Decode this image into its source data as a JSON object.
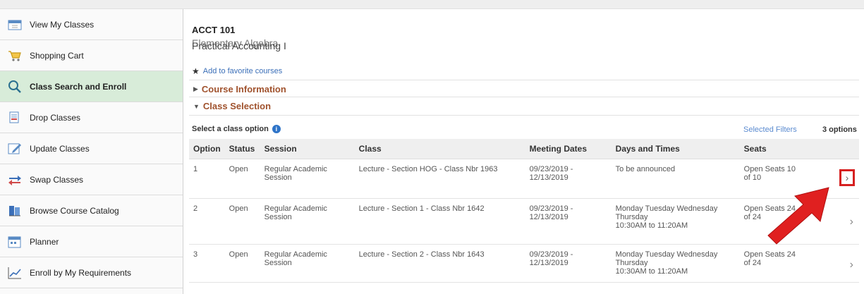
{
  "sidebar": {
    "items": [
      {
        "label": "View My Classes",
        "icon": "calendar-icon"
      },
      {
        "label": "Shopping Cart",
        "icon": "cart-icon"
      },
      {
        "label": "Class Search and Enroll",
        "icon": "search-icon",
        "active": true
      },
      {
        "label": "Drop Classes",
        "icon": "drop-icon"
      },
      {
        "label": "Update Classes",
        "icon": "edit-icon"
      },
      {
        "label": "Swap Classes",
        "icon": "swap-icon"
      },
      {
        "label": "Browse Course Catalog",
        "icon": "catalog-icon"
      },
      {
        "label": "Planner",
        "icon": "planner-icon"
      },
      {
        "label": "Enroll by My Requirements",
        "icon": "chart-icon"
      }
    ]
  },
  "course": {
    "code": "ACCT 101",
    "title_ghost": "Elementary Algebra",
    "title": "Practical Accounting I",
    "favorite_label": "Add to favorite courses"
  },
  "sections": {
    "course_info": "Course Information",
    "class_selection": "Class Selection"
  },
  "selection": {
    "prompt": "Select a class option",
    "filters_label": "Selected Filters",
    "options_count": "3 options"
  },
  "table": {
    "headers": [
      "Option",
      "Status",
      "Session",
      "Class",
      "Meeting Dates",
      "Days and Times",
      "Seats"
    ],
    "rows": [
      {
        "option": "1",
        "status": "Open",
        "session": "Regular Academic Session",
        "class": "Lecture - Section HOG - Class Nbr 1963",
        "dates": "09/23/2019 - 12/13/2019",
        "days": "To be announced",
        "times": "",
        "seats": "Open Seats 10 of 10"
      },
      {
        "option": "2",
        "status": "Open",
        "session": "Regular Academic Session",
        "class": "Lecture - Section 1 - Class Nbr 1642",
        "dates": "09/23/2019 - 12/13/2019",
        "days": "Monday Tuesday Wednesday Thursday",
        "times": "10:30AM to 11:20AM",
        "seats": "Open Seats 24 of 24"
      },
      {
        "option": "3",
        "status": "Open",
        "session": "Regular Academic Session",
        "class": "Lecture - Section 2 - Class Nbr 1643",
        "dates": "09/23/2019 - 12/13/2019",
        "days": "Monday Tuesday Wednesday Thursday",
        "times": "10:30AM to 11:20AM",
        "seats": "Open Seats 24 of 24"
      }
    ]
  },
  "colors": {
    "active_nav": "#d8ecd9",
    "link": "#5b8bd0",
    "section_header": "#a0522d",
    "highlight": "#d62020"
  }
}
